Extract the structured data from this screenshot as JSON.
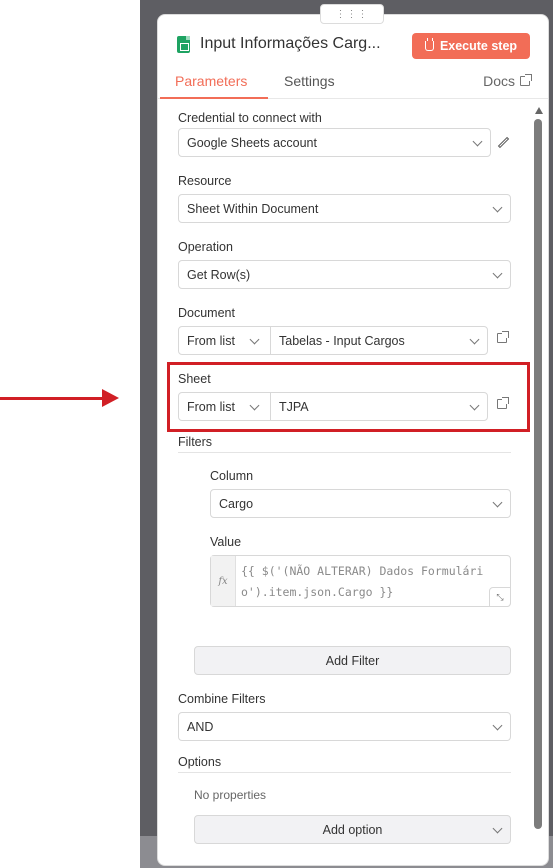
{
  "node": {
    "title": "Input Informações Carg...",
    "execute_label": "Execute step",
    "icon": "google-sheets-icon",
    "accent_color": "#f26d57"
  },
  "tabs": [
    {
      "label": "Parameters",
      "active": true
    },
    {
      "label": "Settings",
      "active": false
    }
  ],
  "docs_label": "Docs",
  "credential": {
    "label": "Credential to connect with",
    "value": "Google Sheets account"
  },
  "resource": {
    "label": "Resource",
    "value": "Sheet Within Document"
  },
  "operation": {
    "label": "Operation",
    "value": "Get Row(s)"
  },
  "document": {
    "label": "Document",
    "mode": "From list",
    "value": "Tabelas - Input Cargos"
  },
  "sheet": {
    "label": "Sheet",
    "mode": "From list",
    "value": "TJPA"
  },
  "filters": {
    "label": "Filters",
    "column_label": "Column",
    "column_value": "Cargo",
    "value_label": "Value",
    "expression_fx": "fx",
    "expression": "{{ $('(NÃO ALTERAR) Dados Formulário').item.json.Cargo }}",
    "add_filter_label": "Add Filter"
  },
  "combine": {
    "label": "Combine Filters",
    "value": "AND"
  },
  "options": {
    "label": "Options",
    "empty_text": "No properties",
    "add_label": "Add option"
  },
  "annotation_color": "#d11f25"
}
